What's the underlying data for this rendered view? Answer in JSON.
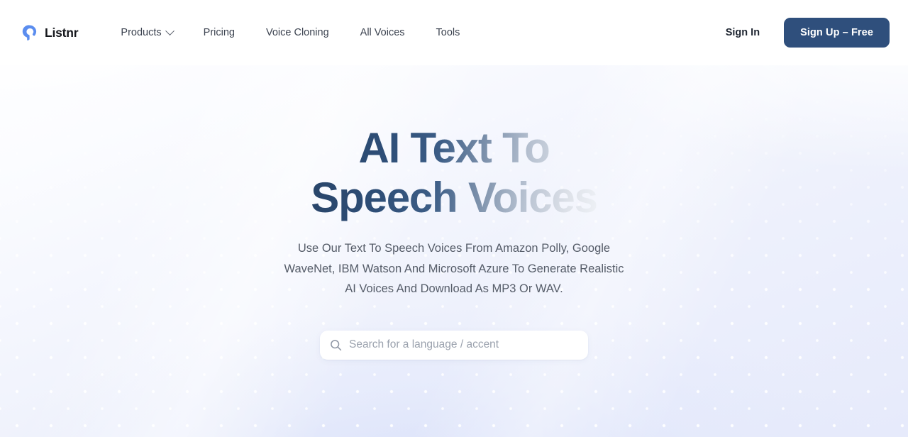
{
  "header": {
    "brand": {
      "name": "Listnr",
      "logo_icon": "listnr-spiral-logo",
      "logo_color": "#5b8def"
    },
    "nav": [
      {
        "label": "Products",
        "has_dropdown": true,
        "dropdown_icon": "chevron-down-icon"
      },
      {
        "label": "Pricing",
        "has_dropdown": false
      },
      {
        "label": "Voice Cloning",
        "has_dropdown": false
      },
      {
        "label": "All Voices",
        "has_dropdown": false
      },
      {
        "label": "Tools",
        "has_dropdown": false
      }
    ],
    "sign_in_label": "Sign In",
    "sign_up_label": "Sign Up – Free",
    "sign_up_color": "#2f4f7c"
  },
  "hero": {
    "title_line_1": "AI Text To",
    "title_line_2": "Speech Voices",
    "title_gradient_from": "#284468",
    "title_gradient_to": "#eef1f6",
    "subtitle": "Use Our Text To Speech Voices From Amazon Polly, Google WaveNet, IBM Watson And Microsoft Azure To Generate Realistic AI Voices And Download As MP3 Or WAV.",
    "search": {
      "placeholder": "Search for a language / accent",
      "value": "",
      "icon": "search-icon"
    }
  }
}
